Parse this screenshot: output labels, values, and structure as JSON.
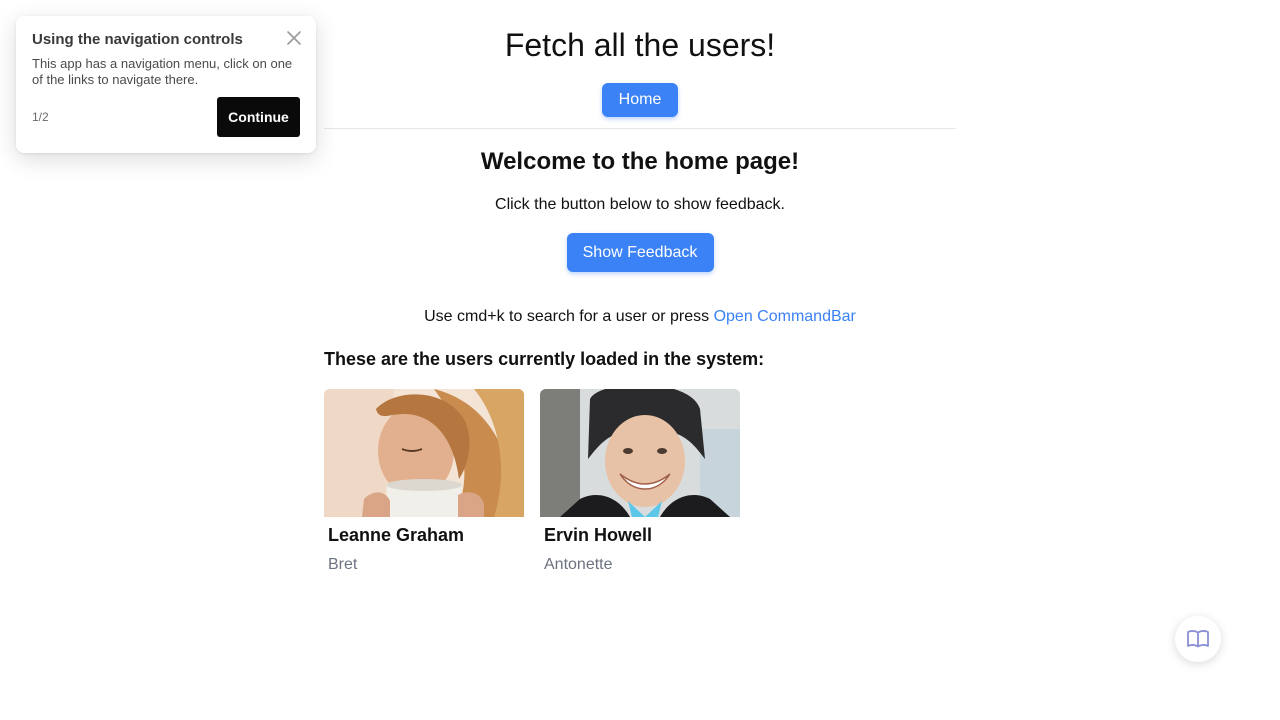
{
  "header": {
    "title": "Fetch all the users!",
    "nav": [
      {
        "label": "Home"
      }
    ]
  },
  "home": {
    "heading": "Welcome to the home page!",
    "instruction": "Click the button below to show feedback.",
    "feedback_button": "Show Feedback",
    "command_prefix": "Use cmd+k to search for a user or press ",
    "command_link": "Open CommandBar",
    "users_heading": "These are the users currently loaded in the system:"
  },
  "users": [
    {
      "name": "Leanne Graham",
      "username": "Bret"
    },
    {
      "name": "Ervin Howell",
      "username": "Antonette"
    }
  ],
  "tour": {
    "title": "Using the navigation controls",
    "body": "This app has a navigation menu, click on one of the links to navigate there.",
    "step": "1/2",
    "continue_label": "Continue",
    "close_icon": "close-icon"
  },
  "help_widget": {
    "icon": "book-open-icon"
  },
  "colors": {
    "accent": "#3b82f6",
    "tour_button": "#0a0a0a",
    "muted_text": "#6b7280",
    "help_icon": "#8b8fd6"
  }
}
